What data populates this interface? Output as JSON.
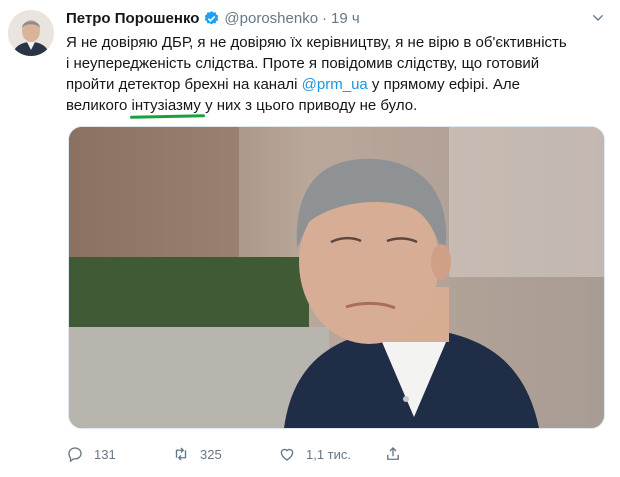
{
  "tweet": {
    "author_name": "Петро Порошенко",
    "author_handle": "@poroshenko",
    "separator": "·",
    "time": "19 ч",
    "text_before_mention": "Я не довіряю ДБР, я не довіряю їх керівництву, я не вірю в об'єктивність\nі неупередженість слідства. Проте я повідомив слідству, що готовий\nпройти детектор брехні на каналі ",
    "mention": "@prm_ua",
    "text_after_mention": " у прямому ефірі. Але\nвеликого ",
    "underlined_word": "інтузіазму",
    "text_end": " у них з цього приводу не було."
  },
  "actions": {
    "replies": "131",
    "retweets": "325",
    "likes": "1,1 тис."
  },
  "icons": {
    "verified": "verified-badge-icon",
    "more": "chevron-down-icon",
    "reply": "reply-icon",
    "retweet": "retweet-icon",
    "like": "heart-icon",
    "share": "share-icon"
  },
  "colors": {
    "accent": "#1da1f2",
    "mention": "#1b95e0",
    "underline_mark": "#18a23c",
    "muted": "#657786"
  }
}
